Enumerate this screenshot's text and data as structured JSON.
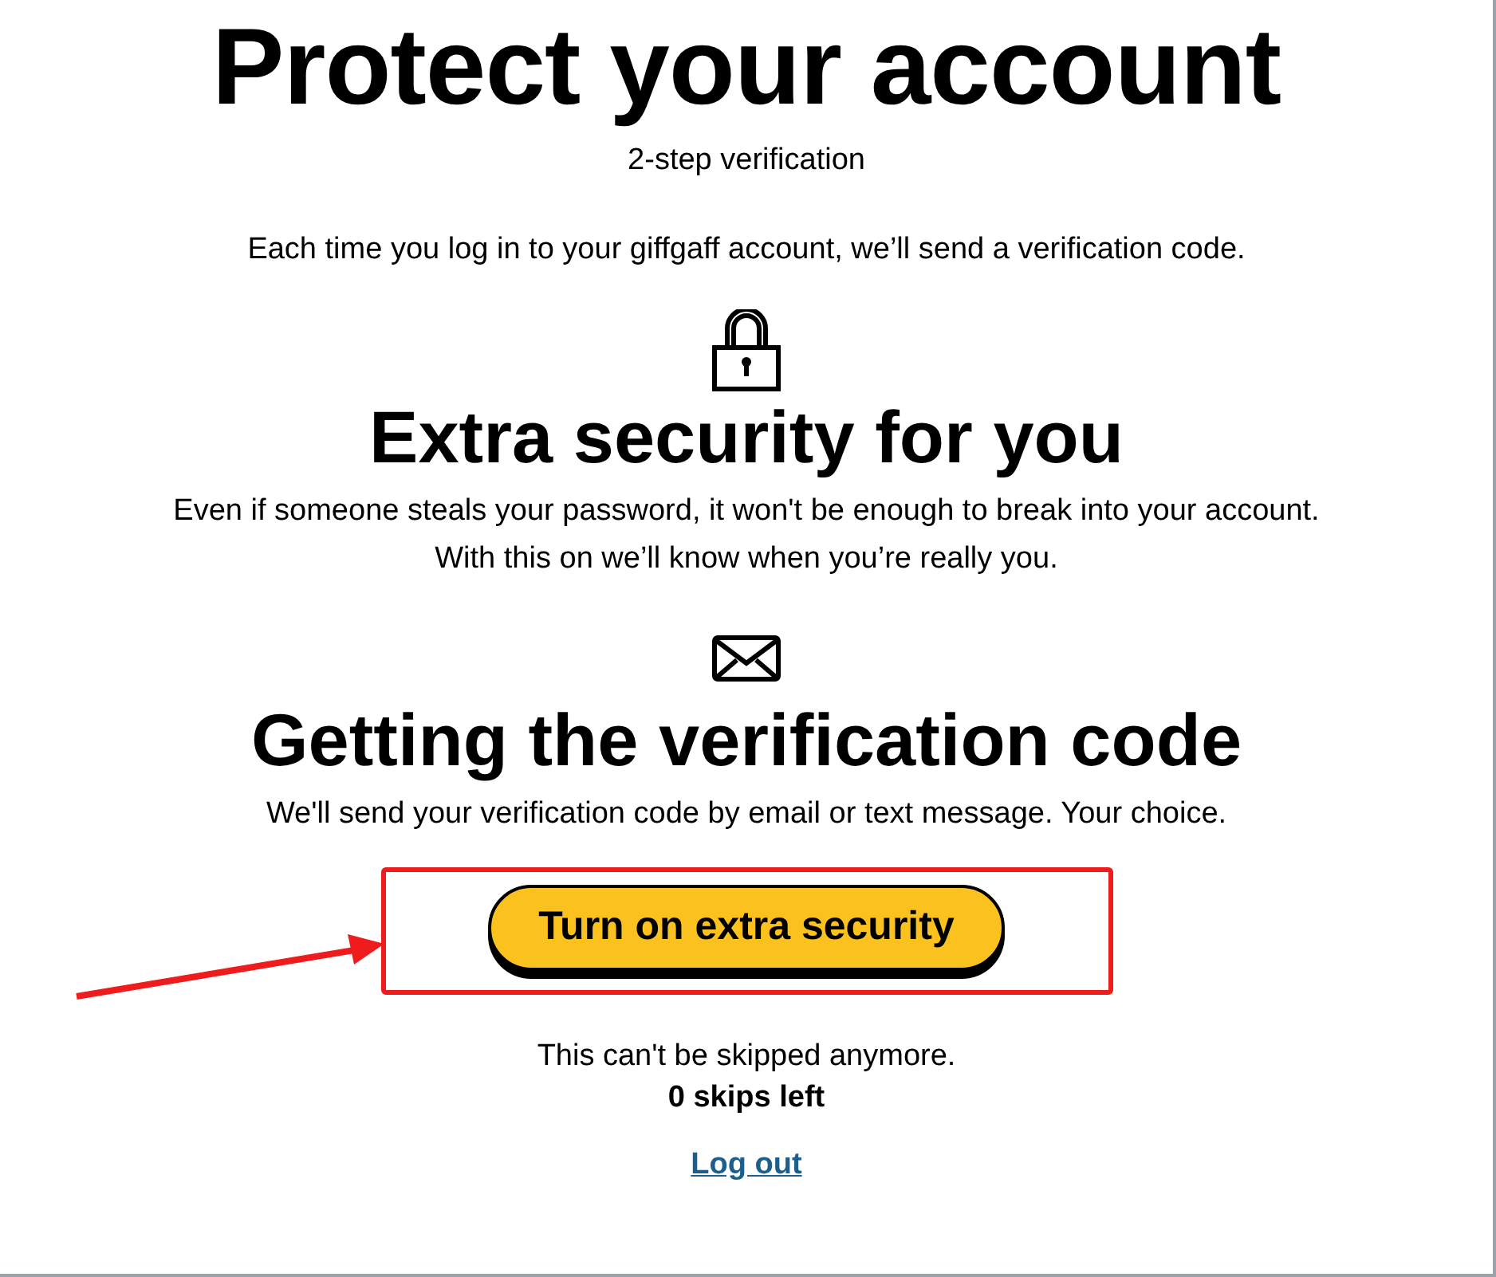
{
  "title": "Protect your account",
  "subtitle": "2-step verification",
  "intro": "Each time you log in to your giffgaff account, we’ll send a verification code.",
  "sections": [
    {
      "kind": "lock",
      "heading": "Extra security for you",
      "text": "Even if someone steals your password, it won't be enough to break into your account. With this on we’ll know when you’re really you."
    },
    {
      "kind": "mail",
      "heading": "Getting the verification code",
      "text": "We'll send your verification code by email or text message. Your choice."
    }
  ],
  "button": "Turn on extra security",
  "notice": "This can't be skipped anymore.",
  "skips": "0 skips left",
  "logout": "Log out"
}
